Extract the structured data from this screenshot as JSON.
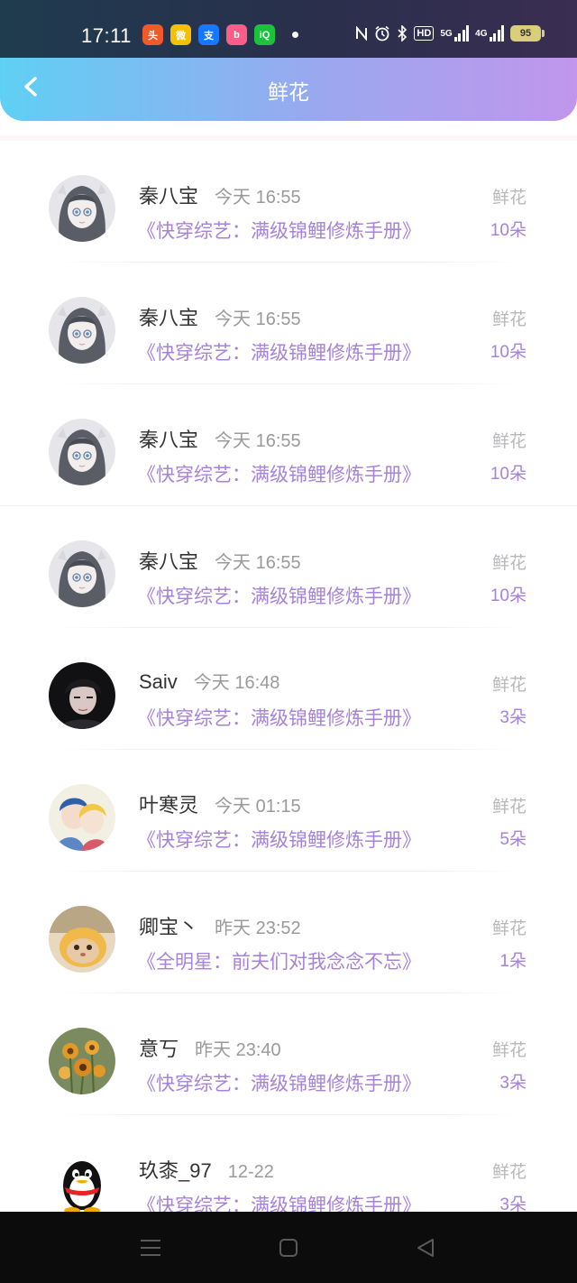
{
  "status_bar": {
    "time": "17:11",
    "app_icons": [
      {
        "name": "toutiao-icon",
        "color": "#f05a28",
        "glyph": "头"
      },
      {
        "name": "weibo-icon",
        "color": "#f6c000",
        "glyph": "微"
      },
      {
        "name": "alipay-icon",
        "color": "#1677ff",
        "glyph": "支"
      },
      {
        "name": "bilibili-icon",
        "color": "#fb5d89",
        "glyph": "b"
      },
      {
        "name": "iqiyi-icon",
        "color": "#1bc23b",
        "glyph": "iQ"
      }
    ],
    "hd": "HD",
    "network_1": "5G",
    "network_2": "4G",
    "battery": "95"
  },
  "header": {
    "title": "鲜花"
  },
  "items": [
    {
      "name": "秦八宝",
      "time": "今天 16:55",
      "book": "《快穿综艺：满级锦鲤修炼手册》",
      "gift": "鲜花",
      "count": "10朵",
      "avatar": "anime-girl"
    },
    {
      "name": "秦八宝",
      "time": "今天 16:55",
      "book": "《快穿综艺：满级锦鲤修炼手册》",
      "gift": "鲜花",
      "count": "10朵",
      "avatar": "anime-girl"
    },
    {
      "name": "秦八宝",
      "time": "今天 16:55",
      "book": "《快穿综艺：满级锦鲤修炼手册》",
      "gift": "鲜花",
      "count": "10朵",
      "avatar": "anime-girl"
    },
    {
      "name": "秦八宝",
      "time": "今天 16:55",
      "book": "《快穿综艺：满级锦鲤修炼手册》",
      "gift": "鲜花",
      "count": "10朵",
      "avatar": "anime-girl"
    },
    {
      "name": "Saiv",
      "time": "今天 16:48",
      "book": "《快穿综艺：满级锦鲤修炼手册》",
      "gift": "鲜花",
      "count": "3朵",
      "avatar": "dark-boy"
    },
    {
      "name": "叶寒灵",
      "time": "今天 01:15",
      "book": "《快穿综艺：满级锦鲤修炼手册》",
      "gift": "鲜花",
      "count": "5朵",
      "avatar": "anime-couple"
    },
    {
      "name": "卿宝丶",
      "time": "昨天 23:52",
      "book": "《全明星：前夫们对我念念不忘》",
      "gift": "鲜花",
      "count": "1朵",
      "avatar": "cat"
    },
    {
      "name": "意丂",
      "time": "昨天 23:40",
      "book": "《快穿综艺：满级锦鲤修炼手册》",
      "gift": "鲜花",
      "count": "3朵",
      "avatar": "flowers"
    },
    {
      "name": "玖桼_97",
      "time": "12-22",
      "book": "《快穿综艺：满级锦鲤修炼手册》",
      "gift": "鲜花",
      "count": "3朵",
      "avatar": "qq-penguin"
    }
  ]
}
